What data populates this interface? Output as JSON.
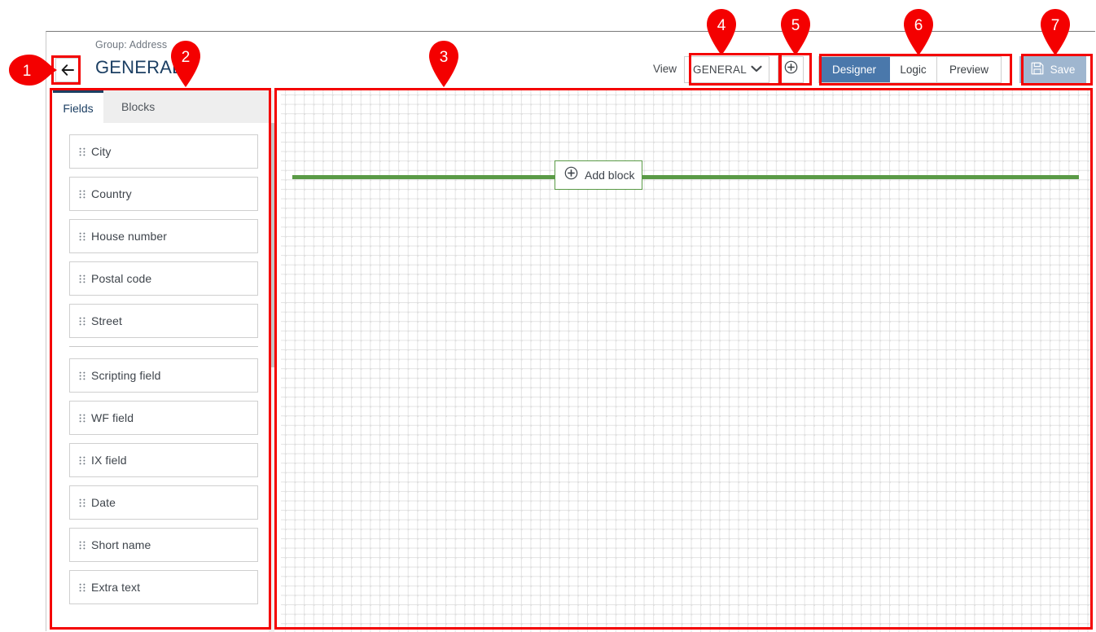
{
  "header": {
    "back_icon": "arrow-left-icon",
    "group_label": "Group: Address",
    "title": "GENERAL"
  },
  "toolbar": {
    "view_label": "View",
    "view_select": {
      "value": "GENERAL",
      "chevron_icon": "chevron-down-icon"
    },
    "add_view_icon": "circle-plus-icon",
    "modes": [
      {
        "label": "Designer",
        "active": true
      },
      {
        "label": "Logic",
        "active": false
      },
      {
        "label": "Preview",
        "active": false
      }
    ],
    "save": {
      "label": "Save",
      "icon": "floppy-disk-icon"
    }
  },
  "sidebar": {
    "tabs": [
      {
        "label": "Fields",
        "active": true
      },
      {
        "label": "Blocks",
        "active": false
      }
    ],
    "drag_handle_icon": "drag-handle-icon",
    "groups": [
      {
        "fields": [
          {
            "label": "City"
          },
          {
            "label": "Country"
          },
          {
            "label": "House number"
          },
          {
            "label": "Postal code"
          },
          {
            "label": "Street"
          }
        ]
      },
      {
        "fields": [
          {
            "label": "Scripting field"
          },
          {
            "label": "WF field"
          },
          {
            "label": "IX field"
          },
          {
            "label": "Date"
          },
          {
            "label": "Short name"
          },
          {
            "label": "Extra text"
          }
        ]
      }
    ]
  },
  "canvas": {
    "add_block": {
      "label": "Add block",
      "icon": "circle-plus-icon"
    }
  },
  "annotations": {
    "color": "#f40000",
    "markers": [
      {
        "number": "1",
        "target": "back-button",
        "direction": "right"
      },
      {
        "number": "2",
        "target": "fields-panel",
        "direction": "down"
      },
      {
        "number": "3",
        "target": "designer-canvas",
        "direction": "down"
      },
      {
        "number": "4",
        "target": "view-select",
        "direction": "down"
      },
      {
        "number": "5",
        "target": "add-view-button",
        "direction": "down"
      },
      {
        "number": "6",
        "target": "mode-switch",
        "direction": "down"
      },
      {
        "number": "7",
        "target": "save-button",
        "direction": "down"
      }
    ]
  },
  "colors": {
    "accent_blue": "#1c3f63",
    "active_mode": "#4a78ab",
    "save_button": "#9fb6cf",
    "drop_line_green": "#5a9a46",
    "annotation_red": "#f40000"
  }
}
